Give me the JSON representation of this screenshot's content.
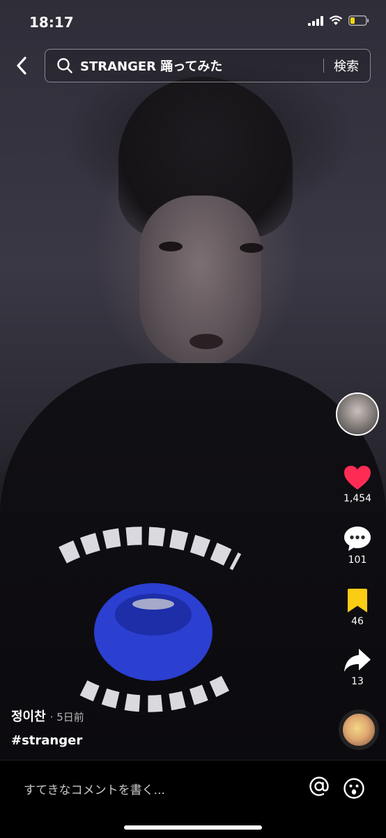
{
  "status_bar": {
    "time": "18:17"
  },
  "search": {
    "query": "STRANGER 踊ってみた",
    "submit_label": "検索"
  },
  "engagement": {
    "likes": "1,454",
    "comments": "101",
    "saves": "46",
    "shares": "13"
  },
  "caption": {
    "author": "정이찬",
    "timestamp": "· 5日前",
    "hashtag": "#stranger"
  },
  "comment_bar": {
    "placeholder": "すてきなコメントを書く..."
  },
  "colors": {
    "like": "#fe2c55",
    "save": "#facc15",
    "battery": "#f5d90a"
  },
  "icons": [
    "back-arrow-icon",
    "search-icon",
    "heart-icon",
    "comment-icon",
    "bookmark-icon",
    "share-icon",
    "at-sign-icon",
    "emoji-icon"
  ]
}
